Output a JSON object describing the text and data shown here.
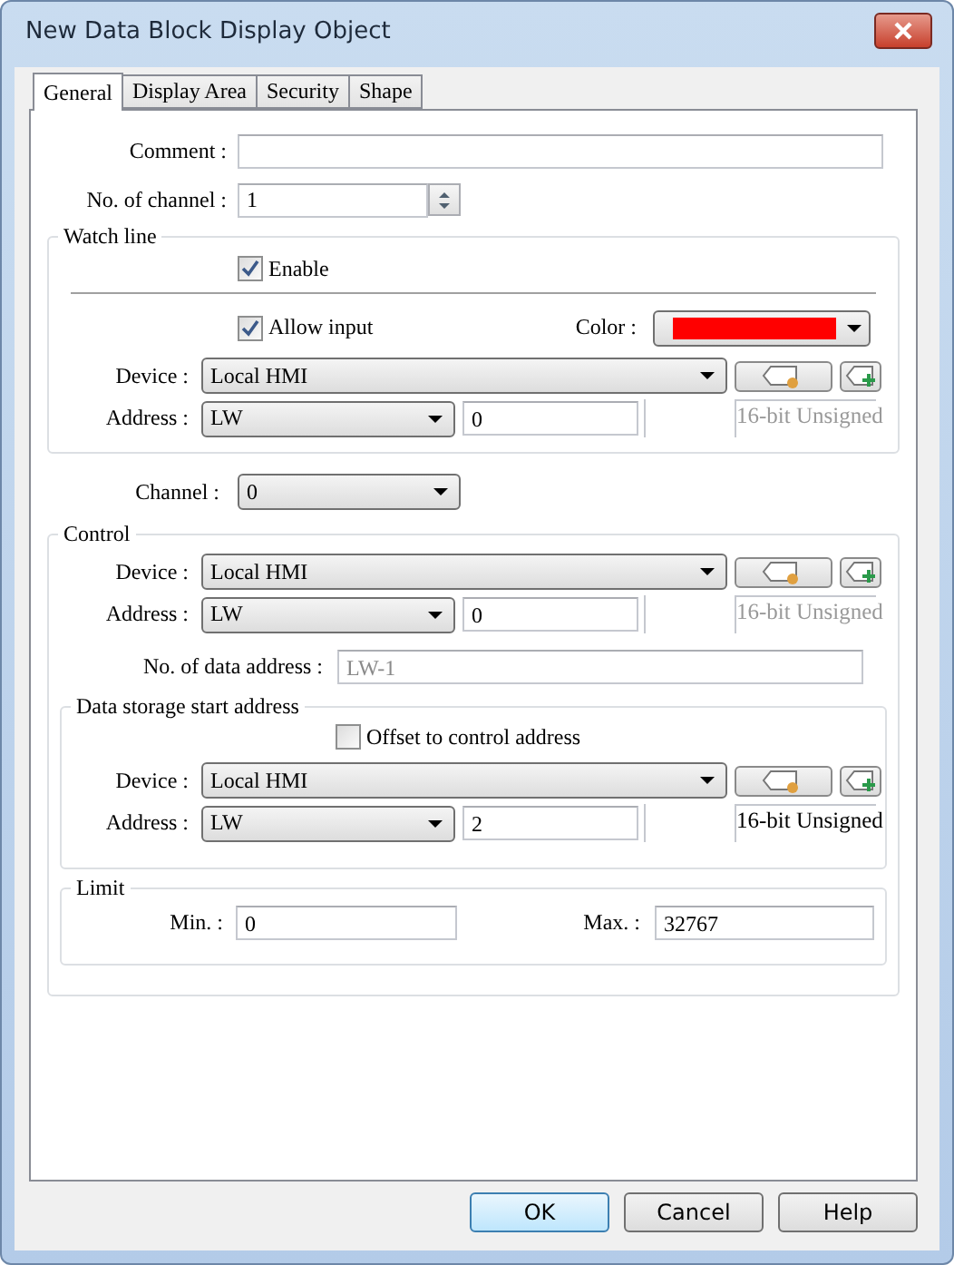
{
  "window": {
    "title": "New Data Block Display Object"
  },
  "tabs": [
    {
      "label": "General",
      "selected": true
    },
    {
      "label": "Display Area",
      "selected": false
    },
    {
      "label": "Security",
      "selected": false
    },
    {
      "label": "Shape",
      "selected": false
    }
  ],
  "comment": {
    "label": "Comment :"
  },
  "channel_count": {
    "label": "No. of channel :",
    "value": "1"
  },
  "watch_line": {
    "title": "Watch line",
    "enable": {
      "label": "Enable",
      "checked": true
    },
    "allow_input": {
      "label": "Allow input",
      "checked": true
    },
    "color": {
      "label": "Color :",
      "color": "#ff0000"
    },
    "device": {
      "label": "Device :",
      "value": "Local HMI"
    },
    "address": {
      "label": "Address :",
      "type": "LW",
      "value": "0",
      "data_type": "16-bit Unsigned",
      "data_type_disabled": true
    }
  },
  "channel": {
    "label": "Channel :",
    "value": "0"
  },
  "control": {
    "title": "Control",
    "device": {
      "label": "Device :",
      "value": "Local HMI"
    },
    "address": {
      "label": "Address :",
      "type": "LW",
      "value": "0",
      "data_type": "16-bit Unsigned",
      "data_type_disabled": true
    },
    "data_address_count": {
      "label": "No. of data address :",
      "value": "LW-1",
      "disabled": true
    },
    "storage": {
      "title": "Data storage start address",
      "offset": {
        "label": "Offset to control address",
        "checked": false
      },
      "device": {
        "label": "Device :",
        "value": "Local HMI"
      },
      "address": {
        "label": "Address :",
        "type": "LW",
        "value": "2",
        "data_type": "16-bit Unsigned",
        "data_type_disabled": false
      }
    },
    "limit": {
      "title": "Limit",
      "min": {
        "label": "Min. :",
        "value": "0"
      },
      "max": {
        "label": "Max. :",
        "value": "32767"
      }
    }
  },
  "buttons": [
    {
      "label": "OK",
      "default": true
    },
    {
      "label": "Cancel",
      "default": false
    },
    {
      "label": "Help",
      "default": false
    }
  ]
}
